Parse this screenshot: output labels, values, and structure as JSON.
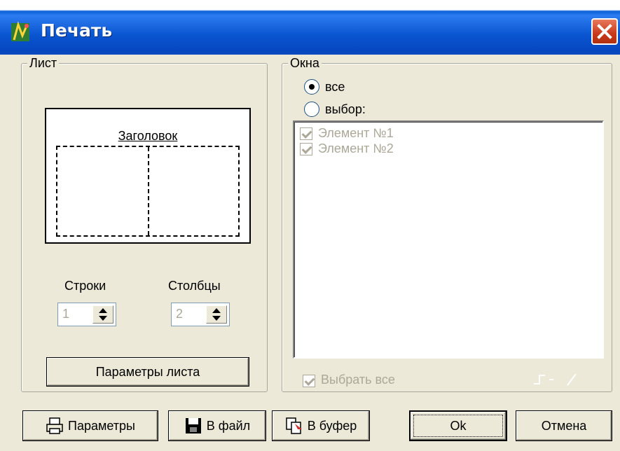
{
  "window": {
    "title": "Печать",
    "icons": {
      "app": "plot-icon",
      "close": "close-icon"
    }
  },
  "sheet_group": {
    "legend": "Лист",
    "preview_caption": "Заголовок",
    "rows_label": "Строки",
    "rows_value": "1",
    "cols_label": "Столбцы",
    "cols_value": "2",
    "page_setup_button": "Параметры листа"
  },
  "windows_group": {
    "legend": "Окна",
    "radio_all": "все",
    "radio_select": "выбор:",
    "selected_radio": "все",
    "items": [
      {
        "label": "Элемент №1",
        "checked": true
      },
      {
        "label": "Элемент №2",
        "checked": true
      }
    ],
    "select_all": "Выбрать все"
  },
  "buttons": {
    "params": "Параметры",
    "to_file": "В файл",
    "to_buffer": "В буфер",
    "ok": "Ok",
    "cancel": "Отмена"
  },
  "colors": {
    "titlebar": "#0a5fd8",
    "dialog_bg": "#ece9d8",
    "close_button": "#c8391a",
    "disabled_text": "#aca899"
  }
}
